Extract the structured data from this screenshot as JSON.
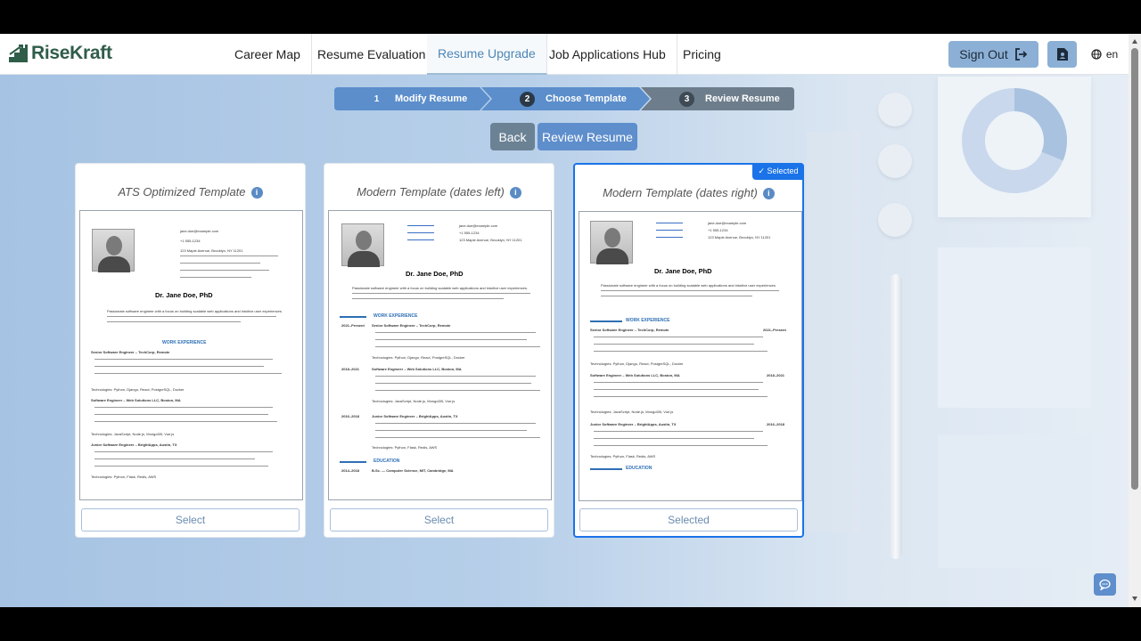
{
  "brand": {
    "name": "RiseKraft",
    "logo_icon": "stairs-logo-icon",
    "color": "#2f5d48"
  },
  "nav": {
    "items": [
      {
        "label": "Career Map"
      },
      {
        "label": "Resume Evaluation"
      },
      {
        "label": "Resume Upgrade",
        "active": true
      },
      {
        "label": "Job Applications Hub"
      },
      {
        "label": "Pricing"
      }
    ],
    "sign_out": "Sign Out",
    "sign_out_icon": "sign-out-icon",
    "doc_icon": "document-user-icon",
    "language": "en",
    "language_icon": "globe-icon"
  },
  "stepper": {
    "steps": [
      {
        "num": "1",
        "label": "Modify Resume",
        "state": "done"
      },
      {
        "num": "2",
        "label": "Choose Template",
        "state": "current"
      },
      {
        "num": "3",
        "label": "Review Resume",
        "state": "pending"
      }
    ]
  },
  "actions": {
    "back": "Back",
    "review": "Review Resume"
  },
  "templates": [
    {
      "title": "ATS Optimized Template",
      "button": "Select",
      "selected": false
    },
    {
      "title": "Modern Template (dates left)",
      "button": "Select",
      "selected": false
    },
    {
      "title": "Modern Template (dates right)",
      "button": "Selected",
      "selected": true,
      "badge": "✓ Selected"
    }
  ],
  "resume_preview": {
    "name": "Dr. Jane Doe, PhD",
    "section_experience": "WORK EXPERIENCE",
    "section_education": "EDUCATION",
    "job1": "Senior Software Engineer – TechCorp, Remote",
    "job2": "Software Engineer – Web Solutions LLC, Boston, MA",
    "job3": "Junior Software Engineer – BrightApps, Austin, TX",
    "edu": "B.Sc. — Computer Science, MIT, Cambridge, MA",
    "dates": [
      "2021–Present",
      "2018–2021",
      "2016–2018",
      "2014–2018"
    ],
    "contact_email": "jane.doe@example.com",
    "contact_phone": "+1 555-1234",
    "contact_address": "123 Maple Avenue, Brooklyn, NY 11201",
    "summary": "Passionate software engineer with a focus on building scalable web applications and intuitive user experiences.",
    "tech1": "Technologies: Python, Django, React, PostgreSQL, Docker",
    "tech2": "Technologies: JavaScript, Node.js, MongoDB, Vue.js",
    "tech3": "Technologies: Python, Flask, Redis, AWS"
  },
  "colors": {
    "accent": "#1a73e8",
    "stepper_active": "#5b8ecb",
    "stepper_pending": "#6d7d8b",
    "section_blue": "#2d6fb5"
  }
}
